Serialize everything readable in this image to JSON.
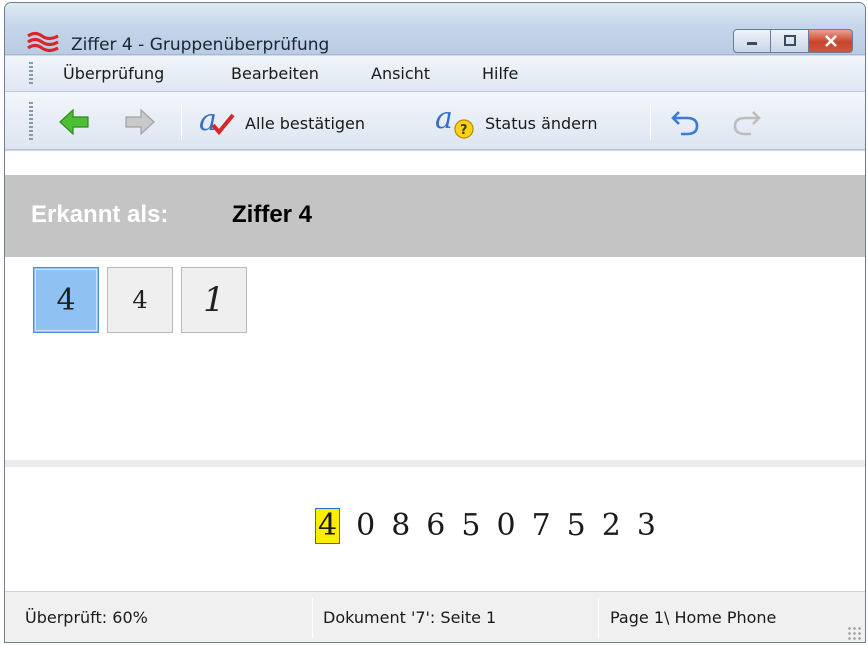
{
  "window": {
    "title": "Ziffer 4 - Gruppenüberprüfung",
    "minimize_icon": "minimize-icon",
    "maximize_icon": "maximize-icon",
    "close_icon": "close-icon"
  },
  "menu": {
    "items": [
      "Überprüfung",
      "Bearbeiten",
      "Ansicht",
      "Hilfe"
    ]
  },
  "toolbar": {
    "back_icon": "arrow-left-icon",
    "forward_icon": "arrow-right-icon",
    "confirm_all_label": "Alle bestätigen",
    "change_status_label": "Status ändern",
    "undo_icon": "undo-icon",
    "redo_icon": "redo-icon"
  },
  "recognition": {
    "label": "Erkannt als:",
    "value": "Ziffer 4"
  },
  "thumbnails": [
    "4",
    "4",
    "1"
  ],
  "digit_strip": [
    "4",
    "0",
    "8",
    "6",
    "5",
    "0",
    "7",
    "5",
    "2",
    "3"
  ],
  "status": {
    "checked": "Überprüft: 60%",
    "document": "Dokument '7': Seite 1",
    "page": "Page 1\\ Home Phone"
  },
  "colors": {
    "accent_green": "#3fae2a",
    "selected_thumb": "#8fc1f3",
    "highlight": "#ffed00",
    "header_gray": "#c4c4c4"
  }
}
